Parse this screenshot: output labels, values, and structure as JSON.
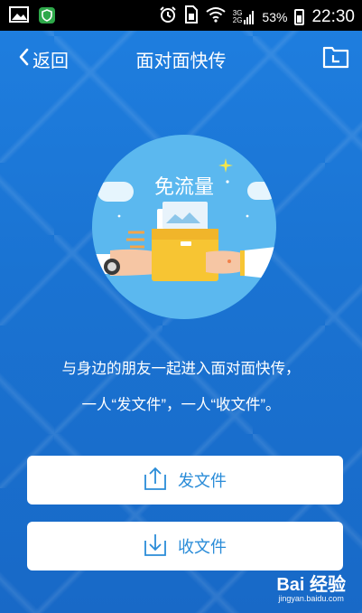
{
  "status_bar": {
    "time": "22:30",
    "battery": "53%",
    "network_3g": "3G",
    "network_2g": "2G"
  },
  "header": {
    "back_label": "返回",
    "title": "面对面快传"
  },
  "hero": {
    "badge": "免流量"
  },
  "description": {
    "line1": "与身边的朋友一起进入面对面快传，",
    "line2": "一人“发文件”，一人“收文件”。"
  },
  "actions": {
    "send_label": "发文件",
    "receive_label": "收文件"
  },
  "watermark": {
    "brand": "Bai 经验",
    "url": "jingyan.baidu.com"
  },
  "colors": {
    "background": "#1a73d2",
    "accent": "#2a8cd8",
    "hero_circle": "#5bb8ef",
    "folder_yellow": "#f7c533"
  },
  "icons": [
    "gallery-icon",
    "shield-app-icon",
    "alarm-icon",
    "sim-icon",
    "wifi-icon",
    "signal-icon",
    "battery-icon",
    "back-chevron-icon",
    "folder-history-icon",
    "upload-icon",
    "download-icon"
  ]
}
